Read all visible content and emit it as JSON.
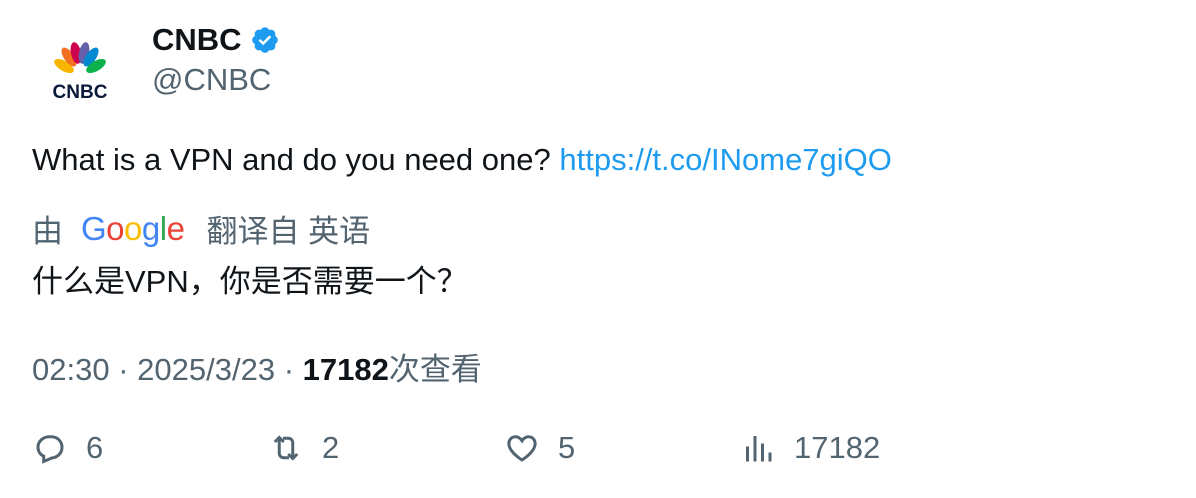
{
  "author": {
    "name": "CNBC",
    "handle": "@CNBC",
    "logo_text": "CNBC",
    "verified": true,
    "verified_color": "#1d9bf0"
  },
  "tweet": {
    "text": "What is a VPN and do you need one?",
    "link": "https://t.co/INome7giQO",
    "link_color": "#1d9bf0"
  },
  "translation": {
    "prefix": "由",
    "provider": "Google",
    "suffix": "翻译自 英语",
    "text": "什么是VPN，你是否需要一个？"
  },
  "meta": {
    "time": "02:30",
    "date": "2025/3/23",
    "separator": "·",
    "views_count": "17182",
    "views_label": "次查看"
  },
  "actions": {
    "replies": "6",
    "retweets": "2",
    "likes": "5",
    "views": "17182"
  }
}
